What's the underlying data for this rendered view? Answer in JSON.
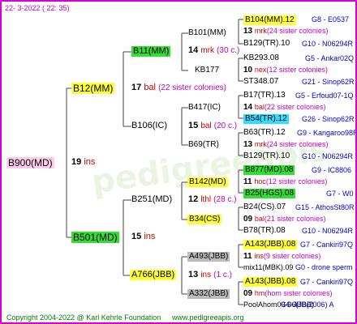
{
  "header": {
    "date": "22-  3-2022 ( 22: 35)"
  },
  "footer": {
    "copyright": "Copyright 2004-2022 @ Karl Kehrle Foundation",
    "url": "www.pedigreeapis.org"
  },
  "colors": {
    "border": "#d400d4",
    "yellow": "#ffff33",
    "green": "#33dd33",
    "pink": "#ffccee",
    "grey": "#bbbbbb",
    "cyan": "#33ddff"
  },
  "root": {
    "name": "B900(MD)",
    "count": "19",
    "suffix": "ins"
  },
  "gen1": [
    {
      "name": "B12(MM)",
      "count": "17",
      "suffix": "bal",
      "note": "(22 sister colonies)"
    },
    {
      "name": "B501(MD)",
      "count": "15",
      "suffix": "ins"
    }
  ],
  "gen2": [
    {
      "name": "B11(MM)",
      "count": "14",
      "suffix": "mrk",
      "note": "(30 c.)"
    },
    {
      "name": "B106(IC)",
      "count": "15",
      "suffix": "bal",
      "note": "(20 c.)"
    },
    {
      "name": "B251(MD)",
      "count": "12",
      "suffix": "lthl",
      "note": "(28 c.)"
    },
    {
      "name": "A766(JBB)",
      "count": "13",
      "suffix": "ins",
      "note": "(1 c.)"
    }
  ],
  "gen3": [
    {
      "name": "B101(MM)"
    },
    {
      "name": "KB177"
    },
    {
      "name": "B417(IC)"
    },
    {
      "name": "B69(TR)"
    },
    {
      "name": "B142(MD)"
    },
    {
      "name": "B34(CS)"
    },
    {
      "name": "A493(JBB)"
    },
    {
      "name": "A332(JBB)"
    }
  ],
  "gen4": [
    {
      "line1": "B104(MM).12",
      "origin1": "G8 - E0537",
      "count": "13",
      "suffix": "mrk",
      "note": "(24 sister colonies)",
      "line3": "B129(TR).10",
      "origin3": "G10 - N06294R"
    },
    {
      "line1": "KB293.08",
      "origin1": "G5 - Ankar02Q",
      "count": "10",
      "suffix": "nex",
      "note": "(12 sister colonies)",
      "line3": "ST348.07",
      "origin3": "G21 - Sinop62R"
    },
    {
      "line1": "B17(TR).13",
      "origin1": "G5 - Erfoud07-1Q",
      "count": "14",
      "suffix": "bal",
      "note": "(22 sister colonies)",
      "line3": "B54(TR).12",
      "origin3": "G26 - Sinop62R"
    },
    {
      "line1": "B63(TR).12",
      "origin1": "G9 - Kangaroo98R",
      "count": "13",
      "suffix": "mrk",
      "note": "(24 sister colonies)",
      "line3": "B129(TR).10",
      "origin3": "G10 - N06294R"
    },
    {
      "line1": "B877(MD).08",
      "origin1": "G9 - IC8806",
      "count": "11",
      "suffix": "hoc",
      "note": "(12 sister colonies)",
      "line3": "B25(HGS).08",
      "origin3": "G7 - W0"
    },
    {
      "line1": "B24(CS).07",
      "origin1": "G15 - AthosSt80R",
      "count": "09",
      "suffix": "bal",
      "note": "(21 sister colonies)",
      "line3": "B78(TR).08",
      "origin3": "G10 - N06294R"
    },
    {
      "line1": "A143(JBB).08",
      "origin1": "G7 - Cankiri97Q",
      "count": "11",
      "suffix": "ins",
      "note": "(9 sister colonies)",
      "line3": "mix11(MBK).09",
      "origin3": "G0 - drone sperm"
    },
    {
      "line1": "A143(JBB).08",
      "origin1": "G7 - Cankiri97Q",
      "count": "09",
      "suffix": "hm",
      "note": "(hom sister colonies)",
      "line3": "PoolAhom09-06(JBB)",
      "origin3": "G6-JBB(2006) A"
    }
  ]
}
